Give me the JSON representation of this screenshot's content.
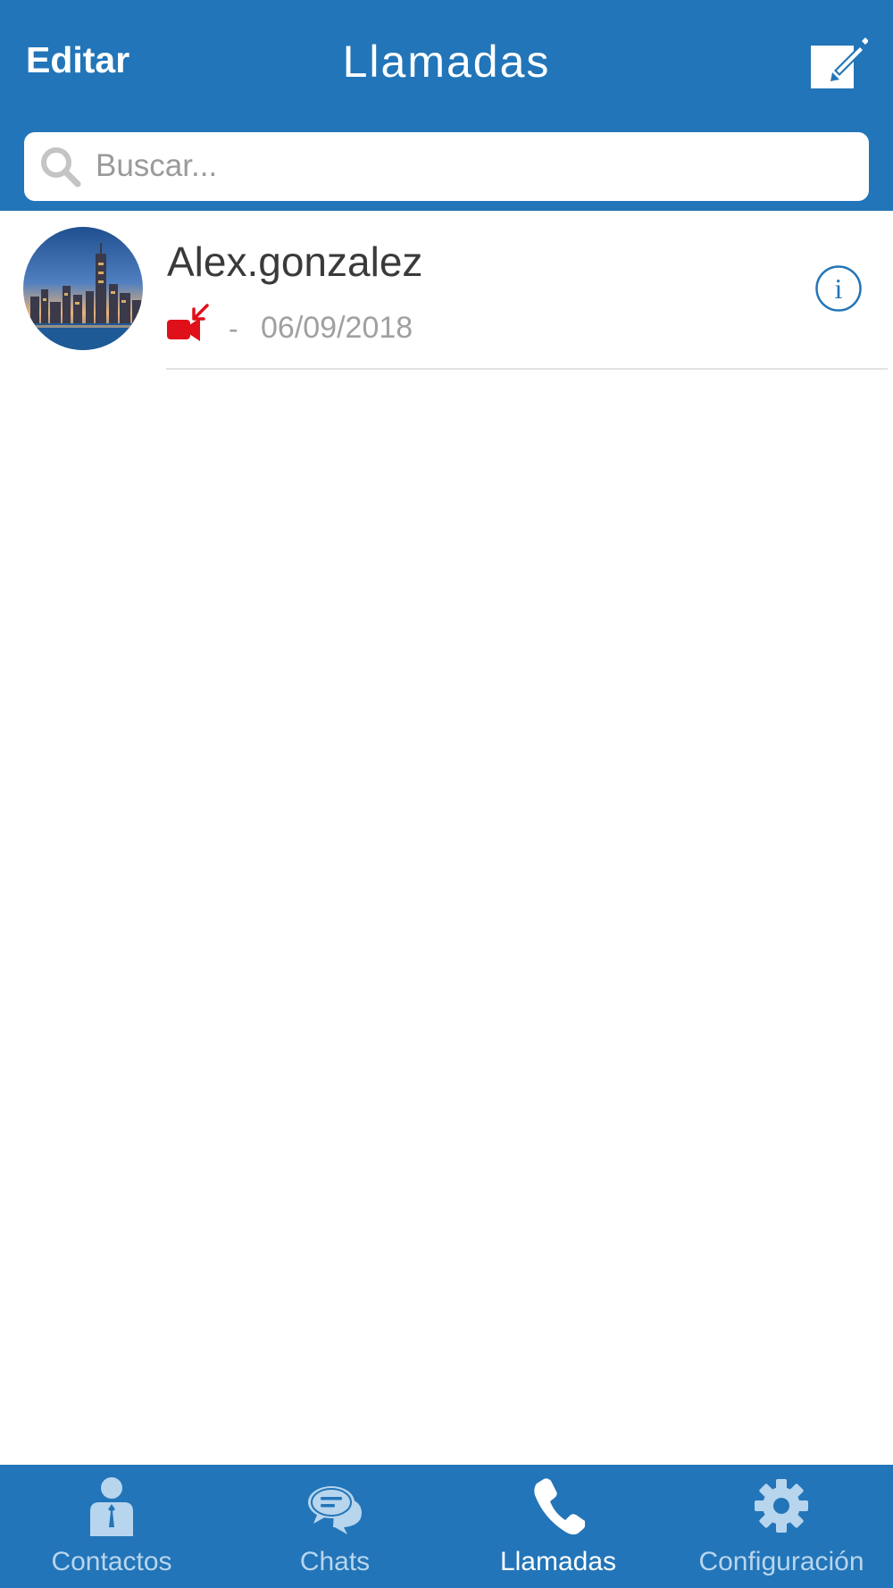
{
  "header": {
    "edit_label": "Editar",
    "title": "Llamadas",
    "compose_icon": "compose-icon",
    "background_color": "#2275b8"
  },
  "search": {
    "placeholder": "Buscar...",
    "value": "",
    "icon": "search-icon"
  },
  "calls": [
    {
      "name": "Alex.gonzalez",
      "call_type_icon": "missed-video-call-icon",
      "call_type_color": "#e0101a",
      "separator": "-",
      "date": "06/09/2018",
      "info_icon": "info-icon"
    }
  ],
  "tabs": [
    {
      "label": "Contactos",
      "icon": "contact-icon",
      "active": false
    },
    {
      "label": "Chats",
      "icon": "chat-bubbles-icon",
      "active": false
    },
    {
      "label": "Llamadas",
      "icon": "phone-icon",
      "active": true
    },
    {
      "label": "Configuración",
      "icon": "gear-icon",
      "active": false
    }
  ],
  "colors": {
    "primary": "#2275b8",
    "tab_inactive": "#b8d5ee",
    "tab_active": "#ffffff",
    "text_primary": "#3a3a3a",
    "text_secondary": "#a0a0a0"
  }
}
